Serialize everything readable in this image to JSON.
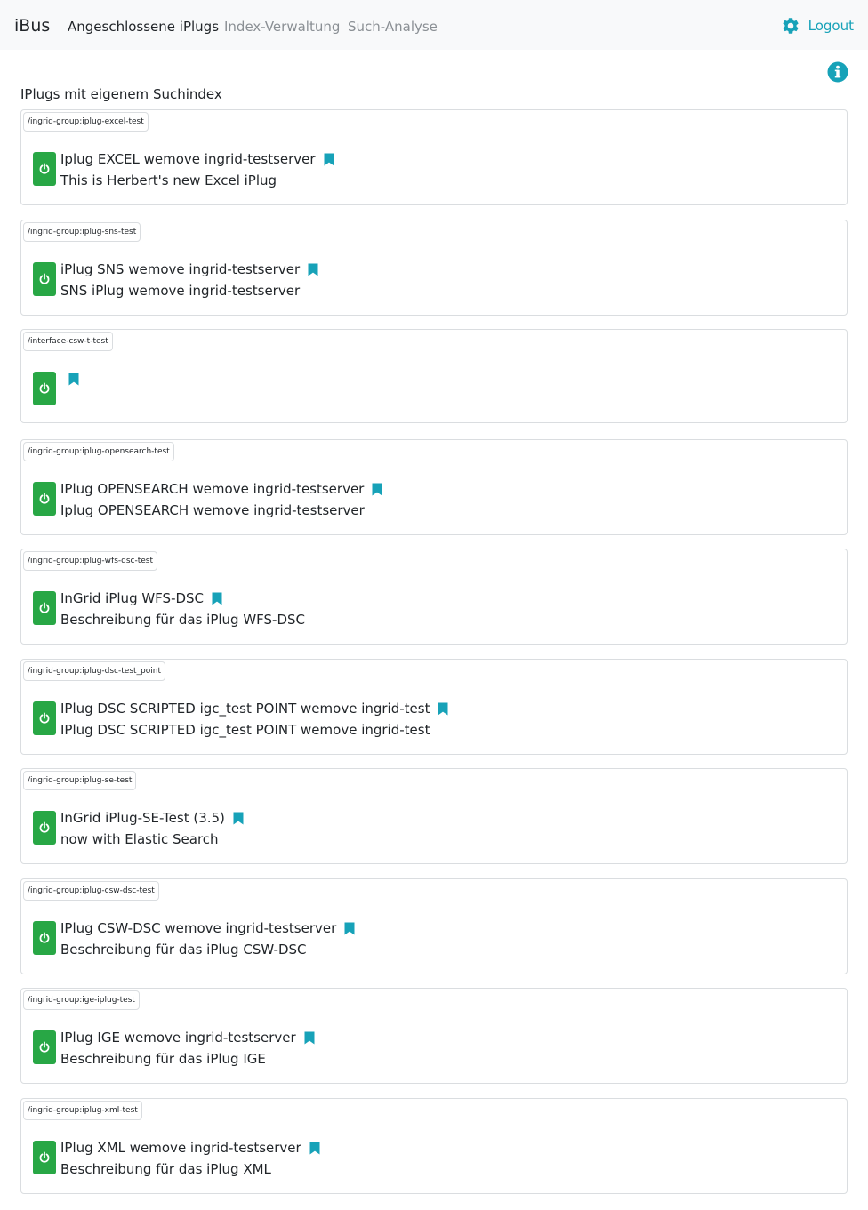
{
  "nav": {
    "brand": "iBus",
    "links": [
      {
        "label": "Angeschlossene iPlugs",
        "active": true
      },
      {
        "label": "Index-Verwaltung",
        "active": false
      },
      {
        "label": "Such-Analyse",
        "active": false
      }
    ],
    "logout_label": "Logout",
    "settings_icon": "gear-icon"
  },
  "info_icon": "info-icon",
  "section_title": "IPlugs mit eigenem Suchindex",
  "colors": {
    "accent": "#17a2b8",
    "power_button": "#28a745",
    "navbar_bg": "#f8f9fa",
    "inactive_link": "#8a8f94"
  },
  "iplugs": [
    {
      "group": "/ingrid-group:iplug-excel-test",
      "title": "Iplug EXCEL wemove ingrid-testserver",
      "description": "This is Herbert's new Excel iPlug",
      "status_icon": "power-icon",
      "bookmark_icon": "bookmark-icon"
    },
    {
      "group": "/ingrid-group:iplug-sns-test",
      "title": "iPlug SNS wemove ingrid-testserver",
      "description": "SNS iPlug wemove ingrid-testserver",
      "status_icon": "power-icon",
      "bookmark_icon": "bookmark-icon"
    },
    {
      "group": "/interface-csw-t-test",
      "title": "",
      "description": "",
      "status_icon": "power-icon",
      "bookmark_icon": "bookmark-icon"
    },
    {
      "group": "/ingrid-group:iplug-opensearch-test",
      "title": "IPlug OPENSEARCH wemove ingrid-testserver",
      "description": "Iplug OPENSEARCH wemove ingrid-testserver",
      "status_icon": "power-icon",
      "bookmark_icon": "bookmark-icon"
    },
    {
      "group": "/ingrid-group:iplug-wfs-dsc-test",
      "title": "InGrid iPlug WFS-DSC",
      "description": "Beschreibung für das iPlug WFS-DSC",
      "status_icon": "power-icon",
      "bookmark_icon": "bookmark-icon"
    },
    {
      "group": "/ingrid-group:iplug-dsc-test_point",
      "title": "IPlug DSC SCRIPTED igc_test POINT wemove ingrid-test",
      "description": "IPlug DSC SCRIPTED igc_test POINT wemove ingrid-test",
      "status_icon": "power-icon",
      "bookmark_icon": "bookmark-icon"
    },
    {
      "group": "/ingrid-group:iplug-se-test",
      "title": "InGrid iPlug-SE-Test (3.5)",
      "description": "now with Elastic Search",
      "status_icon": "power-icon",
      "bookmark_icon": "bookmark-icon"
    },
    {
      "group": "/ingrid-group:iplug-csw-dsc-test",
      "title": "IPlug CSW-DSC wemove ingrid-testserver",
      "description": "Beschreibung für das iPlug CSW-DSC",
      "status_icon": "power-icon",
      "bookmark_icon": "bookmark-icon"
    },
    {
      "group": "/ingrid-group:ige-iplug-test",
      "title": "IPlug IGE wemove ingrid-testserver",
      "description": "Beschreibung für das iPlug IGE",
      "status_icon": "power-icon",
      "bookmark_icon": "bookmark-icon"
    },
    {
      "group": "/ingrid-group:iplug-xml-test",
      "title": "IPlug XML wemove ingrid-testserver",
      "description": "Beschreibung für das iPlug XML",
      "status_icon": "power-icon",
      "bookmark_icon": "bookmark-icon"
    }
  ]
}
